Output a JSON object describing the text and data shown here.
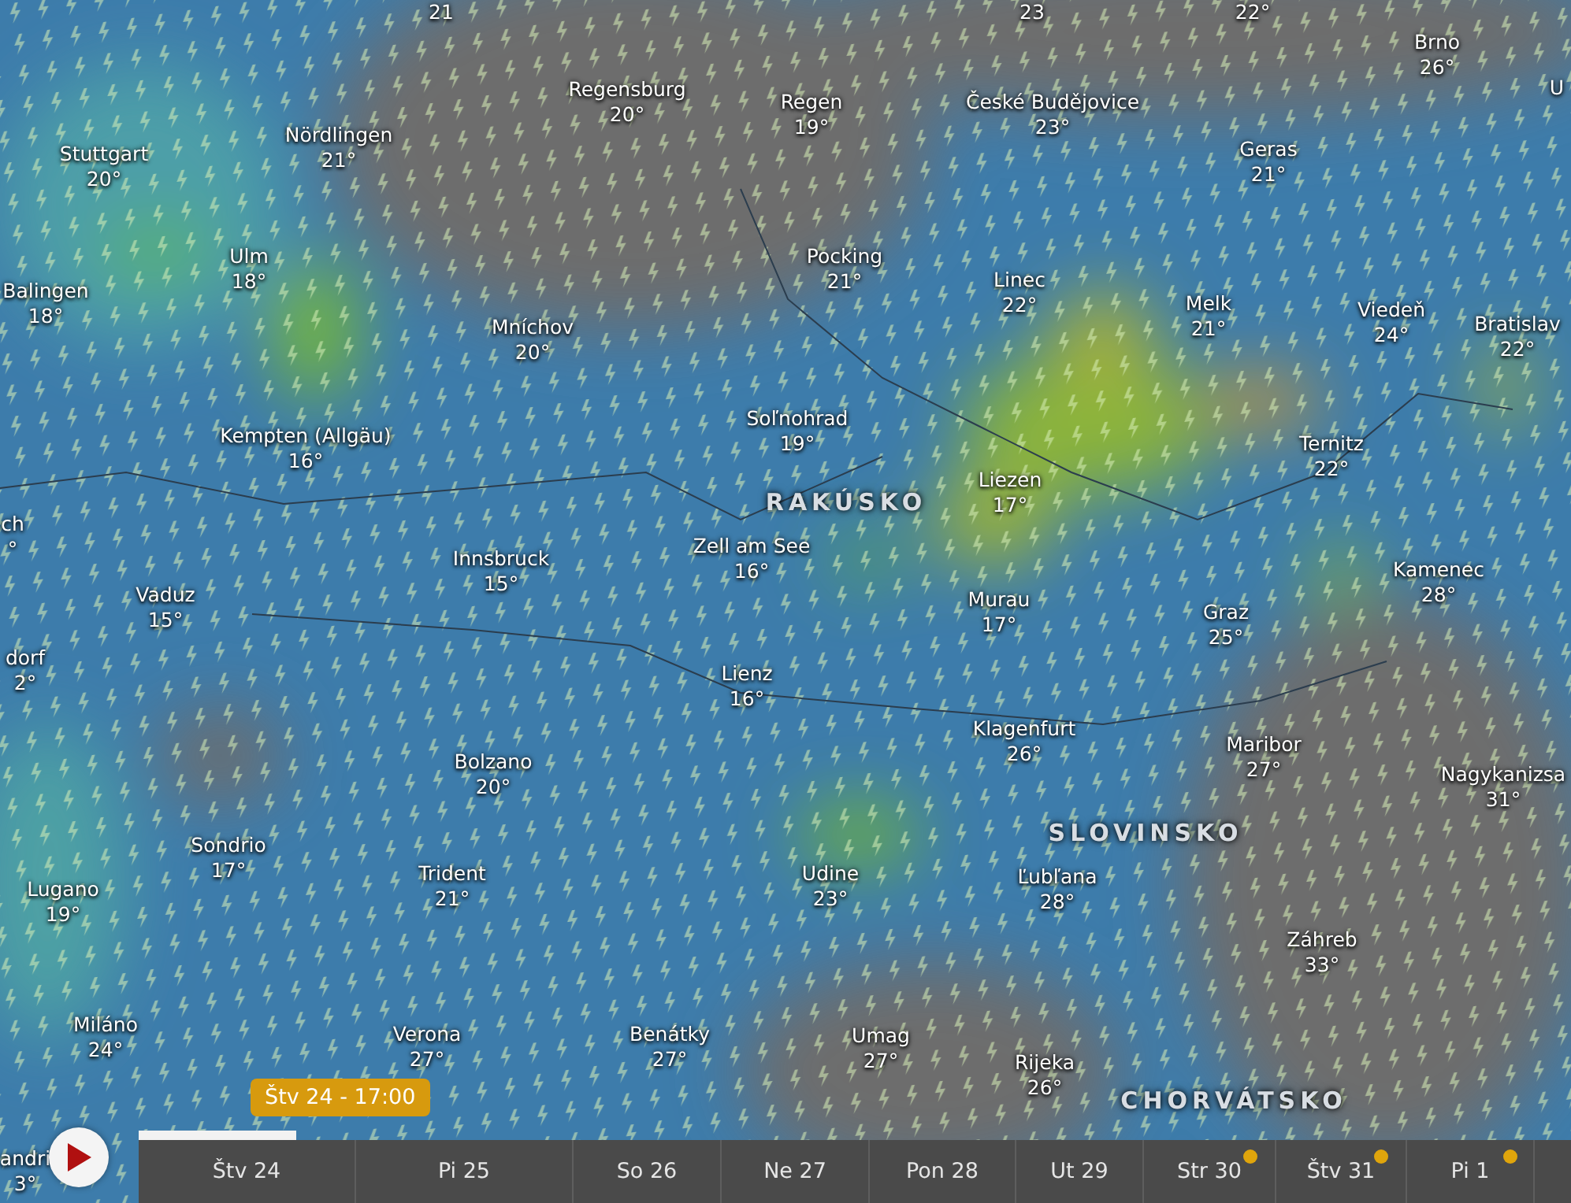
{
  "map": {
    "cities": [
      {
        "temp": "21"
      },
      {
        "temp": "23"
      },
      {
        "temp": "22°"
      },
      {
        "name": "Brno",
        "temp": "26°"
      },
      {
        "name": "U"
      },
      {
        "name": "Regensburg",
        "temp": "20°"
      },
      {
        "name": "Regen",
        "temp": "19°"
      },
      {
        "name": "České Budějovice",
        "temp": "23°"
      },
      {
        "name": "Nördlingen",
        "temp": "21°"
      },
      {
        "name": "Geras",
        "temp": "21°"
      },
      {
        "name": "Stuttgart",
        "temp": "20°"
      },
      {
        "name": "Ulm",
        "temp": "18°"
      },
      {
        "name": "Pocking",
        "temp": "21°"
      },
      {
        "name": "Balingen",
        "temp": "18°"
      },
      {
        "name": "Mníchov",
        "temp": "20°"
      },
      {
        "name": "Linec",
        "temp": "22°"
      },
      {
        "name": "Melk",
        "temp": "21°"
      },
      {
        "name": "Viedeň",
        "temp": "24°"
      },
      {
        "name": "Bratislav",
        "temp": "22°"
      },
      {
        "name": "Soľnohrad",
        "temp": "19°"
      },
      {
        "name": "Kempten (Allgäu)",
        "temp": "16°"
      },
      {
        "name": "Ternitz",
        "temp": "22°"
      },
      {
        "name": "Liezen",
        "temp": "17°"
      },
      {
        "name": "ch",
        "temp": "°"
      },
      {
        "name": "Zell am See",
        "temp": "16°"
      },
      {
        "name": "Innsbruck",
        "temp": "15°"
      },
      {
        "name": "Kamenec",
        "temp": "28°"
      },
      {
        "name": "Vaduz",
        "temp": "15°"
      },
      {
        "name": "Murau",
        "temp": "17°"
      },
      {
        "name": "Graz",
        "temp": "25°"
      },
      {
        "name": "dorf",
        "temp": "2°"
      },
      {
        "name": "Lienz",
        "temp": "16°"
      },
      {
        "name": "Klagenfurt",
        "temp": "26°"
      },
      {
        "name": "Maribor",
        "temp": "27°"
      },
      {
        "name": "Bolzano",
        "temp": "20°"
      },
      {
        "name": "Nagykanizsa",
        "temp": "31°"
      },
      {
        "name": "Sondrio",
        "temp": "17°"
      },
      {
        "name": "Trident",
        "temp": "21°"
      },
      {
        "name": "Udine",
        "temp": "23°"
      },
      {
        "name": "Ľubľana",
        "temp": "28°"
      },
      {
        "name": "Lugano",
        "temp": "19°"
      },
      {
        "name": "Záhreb",
        "temp": "33°"
      },
      {
        "name": "Miláno",
        "temp": "24°"
      },
      {
        "name": "Verona",
        "temp": "27°"
      },
      {
        "name": "Benátky",
        "temp": "27°"
      },
      {
        "name": "Umag",
        "temp": "27°"
      },
      {
        "name": "Rijeka",
        "temp": "26°"
      },
      {
        "name": "andri",
        "temp": "3°"
      }
    ],
    "countries": [
      "RAKÚSKO",
      "SLOVINSKO",
      "CHORVÁTSKO"
    ]
  },
  "timeline": {
    "cursor": "Štv 24 - 17:00",
    "level": 0.11,
    "days": [
      {
        "label": "Štv 24",
        "premium": false
      },
      {
        "label": "Pi 25",
        "premium": false
      },
      {
        "label": "So 26",
        "premium": false
      },
      {
        "label": "Ne 27",
        "premium": false
      },
      {
        "label": "Pon 28",
        "premium": false
      },
      {
        "label": "Ut 29",
        "premium": false
      },
      {
        "label": "Str 30",
        "premium": true
      },
      {
        "label": "Štv 31",
        "premium": true
      },
      {
        "label": "Pi 1",
        "premium": true
      }
    ]
  }
}
